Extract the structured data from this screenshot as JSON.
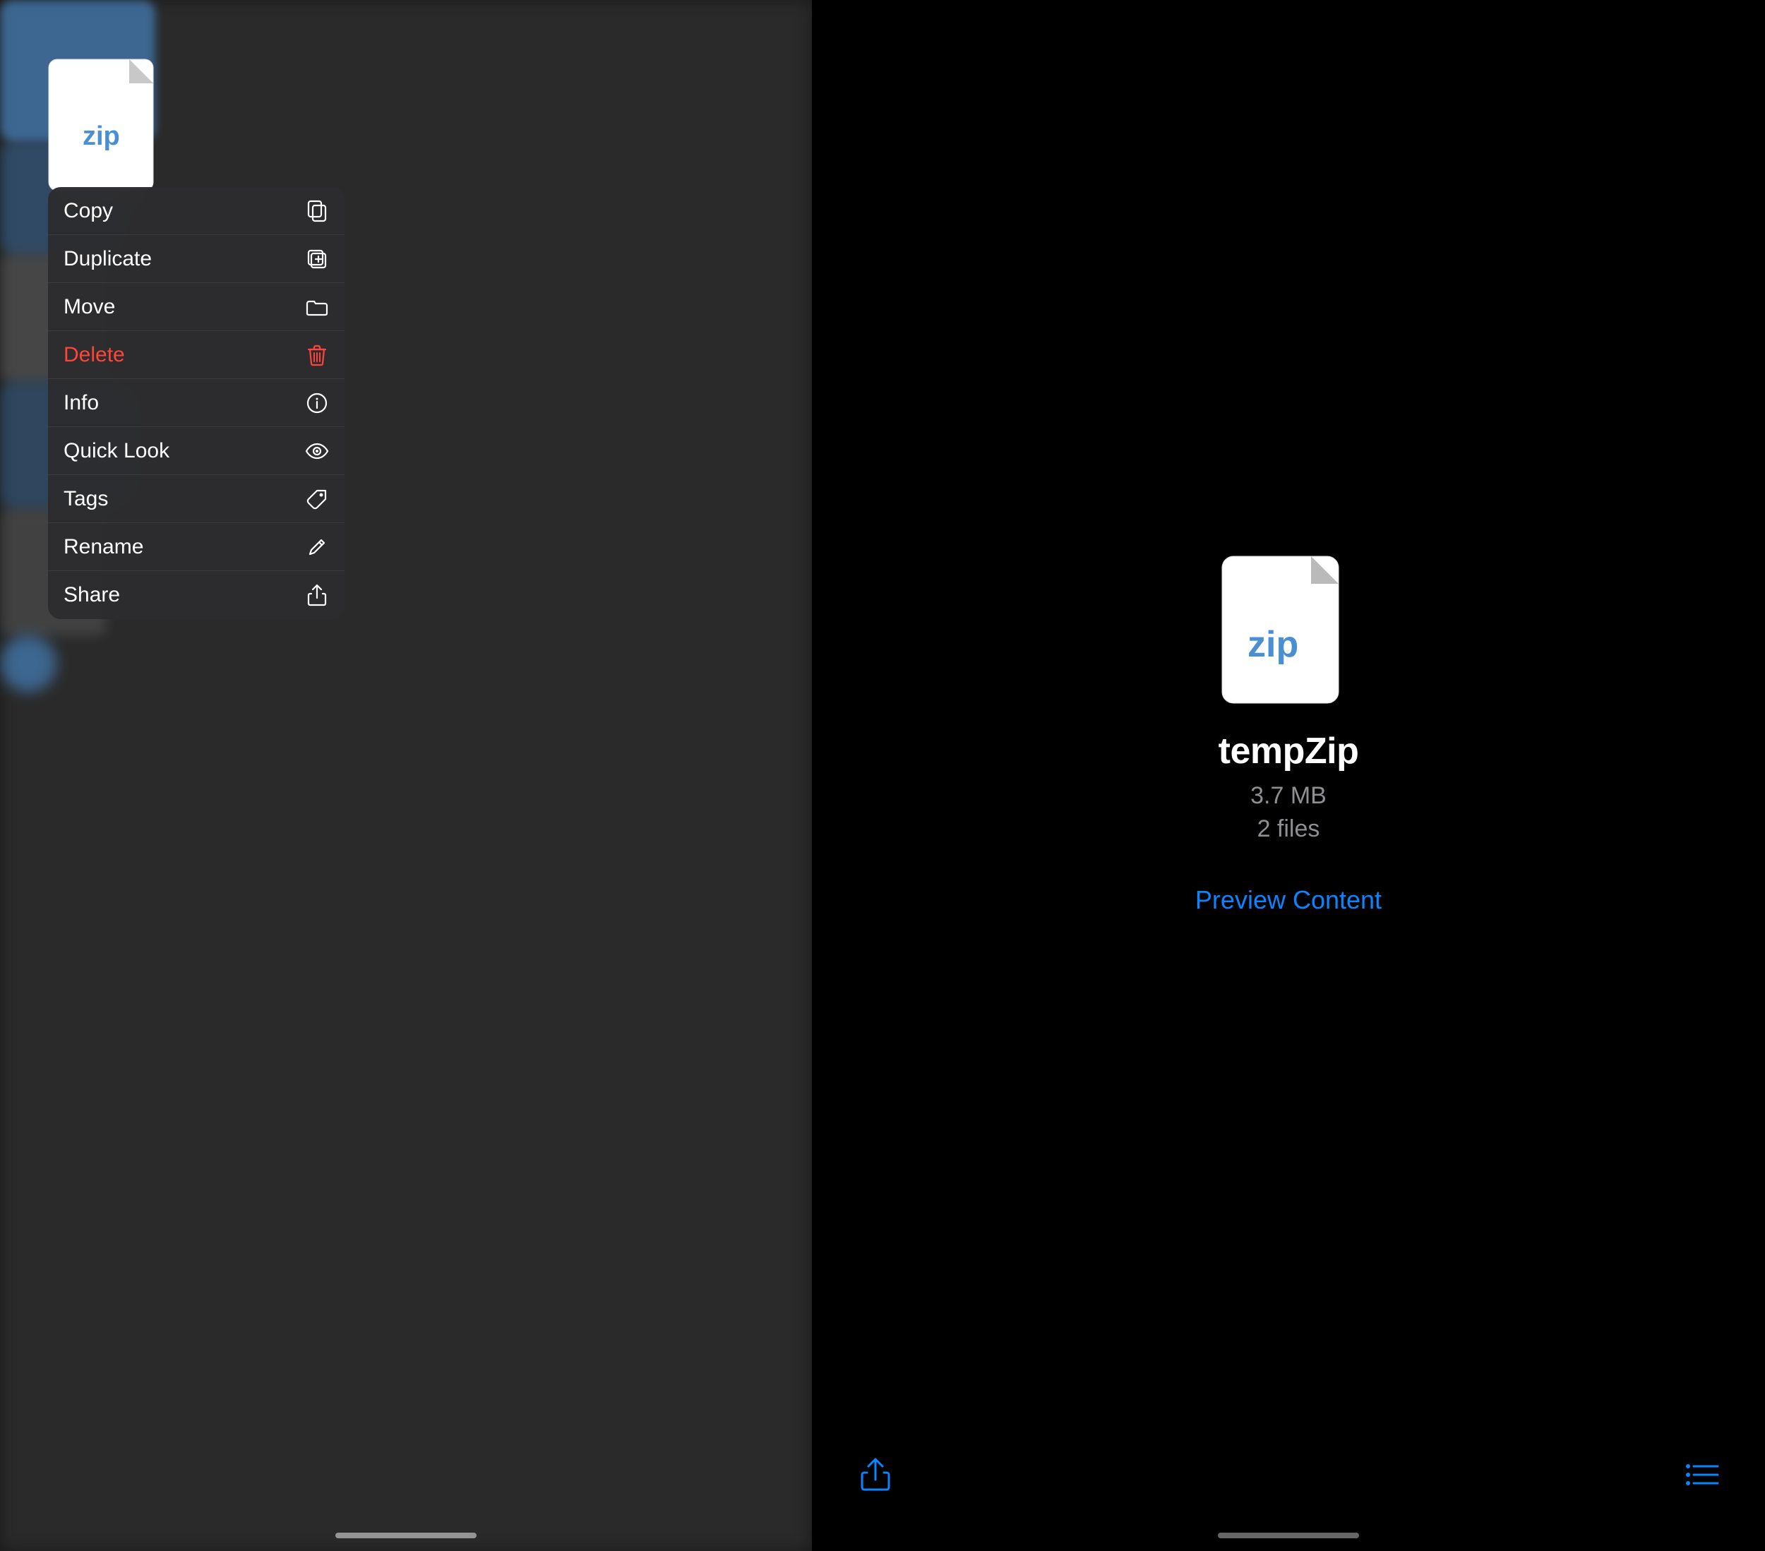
{
  "leftPanel": {
    "contextMenu": {
      "items": [
        {
          "id": "copy",
          "label": "Copy",
          "icon": "copy-icon",
          "isDestructive": false
        },
        {
          "id": "duplicate",
          "label": "Duplicate",
          "icon": "duplicate-icon",
          "isDestructive": false
        },
        {
          "id": "move",
          "label": "Move",
          "icon": "move-icon",
          "isDestructive": false
        },
        {
          "id": "delete",
          "label": "Delete",
          "icon": "trash-icon",
          "isDestructive": true
        },
        {
          "id": "info",
          "label": "Info",
          "icon": "info-icon",
          "isDestructive": false
        },
        {
          "id": "quicklook",
          "label": "Quick Look",
          "icon": "eye-icon",
          "isDestructive": false
        },
        {
          "id": "tags",
          "label": "Tags",
          "icon": "tag-icon",
          "isDestructive": false
        },
        {
          "id": "rename",
          "label": "Rename",
          "icon": "pencil-icon",
          "isDestructive": false
        },
        {
          "id": "share",
          "label": "Share",
          "icon": "share-icon",
          "isDestructive": false
        }
      ]
    }
  },
  "rightPanel": {
    "fileName": "tempZip",
    "fileSize": "3.7 MB",
    "fileCount": "2 files",
    "previewButton": "Preview Content",
    "fileIcon": "zip"
  },
  "colors": {
    "accent": "#0a84ff",
    "destructive": "#ff453a",
    "menuBg": "rgba(44,44,46,0.97)",
    "labelWhite": "#ffffff",
    "labelGray": "#8e8e93"
  }
}
